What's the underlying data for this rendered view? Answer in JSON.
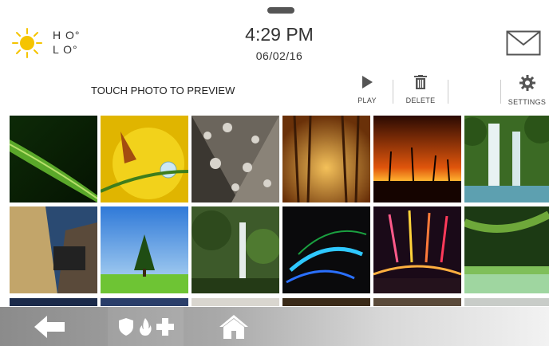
{
  "status_bar": {
    "hi_label": "H O°",
    "lo_label": "L O°",
    "time": "4:29 PM",
    "date": "06/02/16",
    "weather_icon": "sun-icon",
    "messages_icon": "envelope-icon"
  },
  "toolbar": {
    "prompt": "TOUCH PHOTO TO PREVIEW",
    "play_label": "PLAY",
    "delete_label": "DELETE",
    "settings_label": "SETTINGS"
  },
  "photos": [
    {
      "subject": "leaf with water drops"
    },
    {
      "subject": "butterfly on flower"
    },
    {
      "subject": "water drops on leaf"
    },
    {
      "subject": "misty forest"
    },
    {
      "subject": "palm sunset"
    },
    {
      "subject": "waterfall"
    },
    {
      "subject": "canyon pathway"
    },
    {
      "subject": "lone tree in field"
    },
    {
      "subject": "jungle waterfall"
    },
    {
      "subject": "light streaks"
    },
    {
      "subject": "fireworks over bridge"
    },
    {
      "subject": "tropical lagoon"
    }
  ],
  "bottom_nav": {
    "back_icon": "back-arrow-icon",
    "emergency_icons": [
      "shield-icon",
      "fire-icon",
      "medical-cross-icon"
    ],
    "home_icon": "home-icon"
  },
  "colors": {
    "sun": "#f5c400",
    "nav_bar_start": "#8b8b8b",
    "nav_bar_end": "#f2f2f2"
  }
}
